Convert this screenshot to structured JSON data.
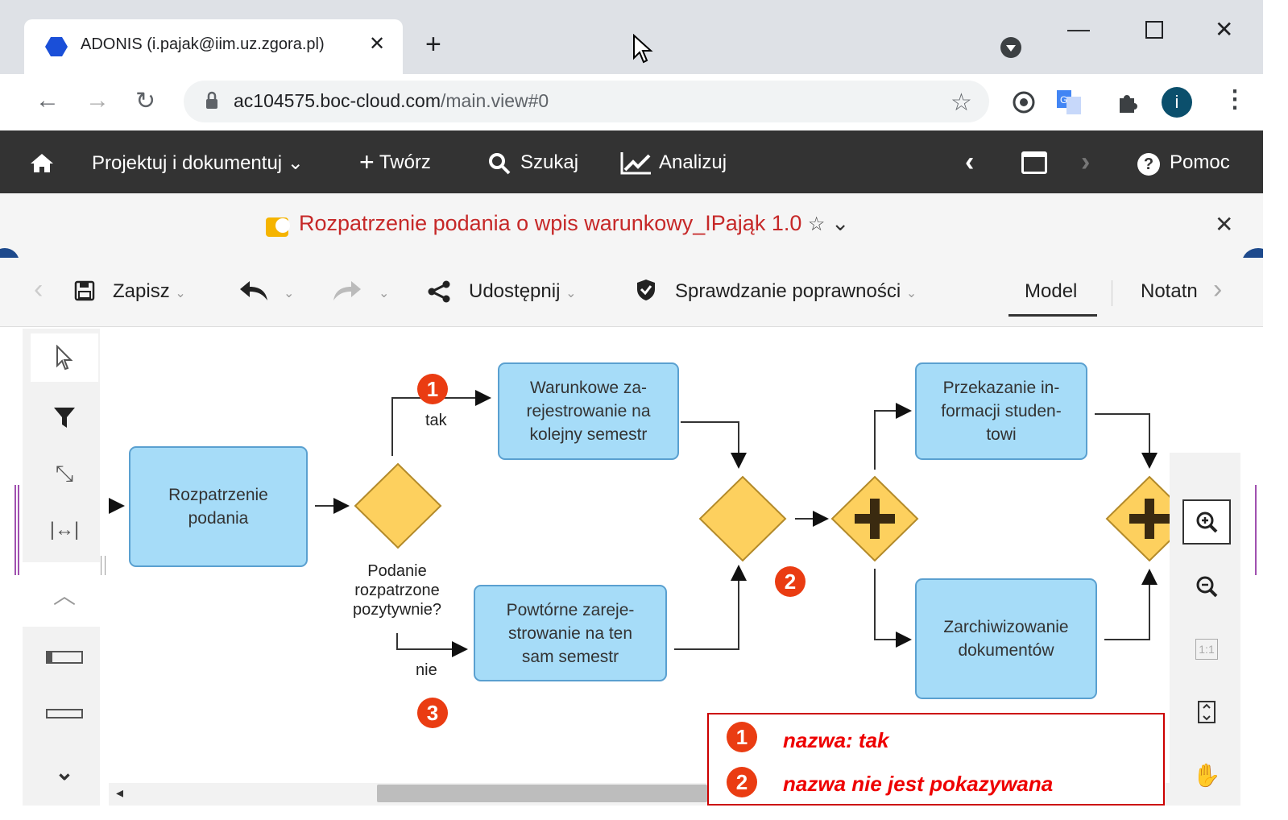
{
  "browser": {
    "tab_title": "ADONIS (i.pajak@iim.uz.zgora.pl)",
    "tab_close": "✕",
    "new_tab": "+",
    "url_host": "ac104575.boc-cloud.com",
    "url_path": "/main.view#0",
    "profile_initial": "i"
  },
  "menu": {
    "design": "Projektuj i dokumentuj",
    "create": "Twórz",
    "search": "Szukaj",
    "analyze": "Analizuj",
    "help": "Pomoc"
  },
  "model": {
    "title": "Rozpatrzenie podania o wpis warunkowy_IPająk 1.0"
  },
  "toolbar": {
    "save": "Zapisz",
    "share": "Udostępnij",
    "validation": "Sprawdzanie poprawności",
    "tab_model": "Model",
    "tab_notes": "Notatn"
  },
  "diagram": {
    "task_review": "Rozpatrzenie podania",
    "task_conditional": "Warunkowe za-rejestrowanie na kolejny semestr",
    "task_repeat": "Powtórne zareje-strowanie na ten sam semestr",
    "task_inform": "Przekazanie in-formacji studen-towi",
    "task_archive": "Zarchiwizowanie dokumentów",
    "gateway_label": "Podanie rozpatrzone pozytywnie?",
    "edge_yes": "tak",
    "edge_no": "nie",
    "marker_1": "1",
    "marker_2": "2",
    "marker_3": "3"
  },
  "zoom": {
    "one_to_one": "1:1"
  },
  "legend": {
    "marker_1": "1",
    "text_1": "nazwa: tak",
    "marker_2": "2",
    "text_2": "nazwa nie jest pokazywana"
  },
  "colors": {
    "task_fill": "#a6dcf8",
    "gateway_fill": "#fdd05e",
    "marker": "#ea3c12",
    "title_red": "#c62828",
    "menubar": "#333333"
  }
}
